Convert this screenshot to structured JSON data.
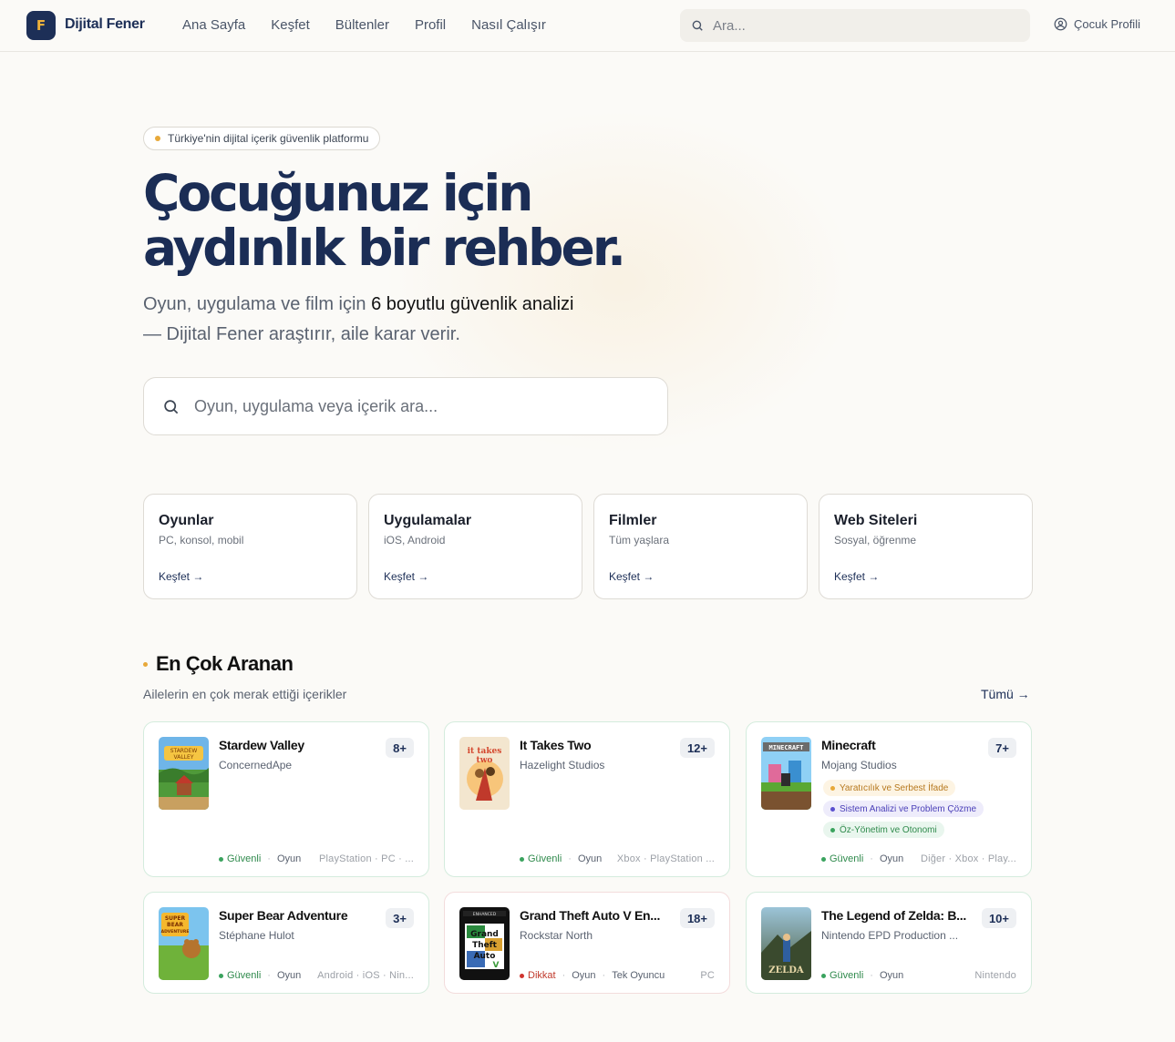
{
  "header": {
    "logo_letter": "F",
    "logo_text": "Dijital Fener",
    "nav": [
      "Ana Sayfa",
      "Keşfet",
      "Bültenler",
      "Profil",
      "Nasıl Çalışır"
    ],
    "search_placeholder": "Ara...",
    "profile_label": "Çocuk Profili"
  },
  "hero": {
    "badge": "Türkiye'nin dijital içerik güvenlik platformu",
    "title_line1": "Çocuğunuz için",
    "title_line2": "aydınlık bir rehber.",
    "sub_pre": "Oyun, uygulama ve film için ",
    "sub_bold": "6 boyutlu güvenlik analizi",
    "sub_post": "— Dijital Fener araştırır, aile karar verir.",
    "search_placeholder": "Oyun, uygulama veya içerik ara..."
  },
  "categories": [
    {
      "title": "Oyunlar",
      "desc": "PC, konsol, mobil",
      "link": "Keşfet →"
    },
    {
      "title": "Uygulamalar",
      "desc": "iOS, Android",
      "link": "Keşfet →"
    },
    {
      "title": "Filmler",
      "desc": "Tüm yaşlara",
      "link": "Keşfet →"
    },
    {
      "title": "Web Siteleri",
      "desc": "Sosyal, öğrenme",
      "link": "Keşfet →"
    }
  ],
  "section": {
    "title": "En Çok Aranan",
    "subtitle": "Ailelerin en çok merak ettiği içerikler",
    "all_link": "Tümü →"
  },
  "games": [
    {
      "name": "Stardew Valley",
      "dev": "ConcernedApe",
      "age": "8+",
      "status": "Güvenli",
      "type": "Oyun",
      "extra": "",
      "platforms": "PlayStation · PC · ...",
      "cover": "stardew"
    },
    {
      "name": "It Takes Two",
      "dev": "Hazelight Studios",
      "age": "12+",
      "status": "Güvenli",
      "type": "Oyun",
      "extra": "",
      "platforms": "Xbox · PlayStation ...",
      "cover": "ittakestwo"
    },
    {
      "name": "Minecraft",
      "dev": "Mojang Studios",
      "age": "7+",
      "status": "Güvenli",
      "type": "Oyun",
      "extra": "",
      "platforms": "Diğer · Xbox · Play...",
      "cover": "minecraft",
      "tags": [
        {
          "label": "Yaratıcılık ve Serbest İfade",
          "color": "#e8a93a",
          "bg": "#fdf4e3",
          "text": "#b7791f"
        },
        {
          "label": "Sistem Analizi ve Problem Çözme",
          "color": "#5a4fcf",
          "bg": "#eeecfb",
          "text": "#4a3fb8"
        },
        {
          "label": "Öz-Yönetim ve Otonomi",
          "color": "#3aa35e",
          "bg": "#e9f6ee",
          "text": "#2f8a4c"
        }
      ]
    },
    {
      "name": "Super Bear Adventure",
      "dev": "Stéphane Hulot",
      "age": "3+",
      "status": "Güvenli",
      "type": "Oyun",
      "extra": "",
      "platforms": "Android · iOS · Nin...",
      "cover": "superbear"
    },
    {
      "name": "Grand Theft Auto V En...",
      "dev": "Rockstar North",
      "age": "18+",
      "status": "Dikkat",
      "type": "Oyun",
      "extra": "Tek Oyuncu",
      "platforms": "PC",
      "cover": "gta"
    },
    {
      "name": "The Legend of Zelda: B...",
      "dev": "Nintendo EPD Production ...",
      "age": "10+",
      "status": "Güvenli",
      "type": "Oyun",
      "extra": "",
      "platforms": "Nintendo",
      "cover": "zelda"
    }
  ],
  "colors": {
    "navy": "#1d2f57",
    "accent": "#e8a93a",
    "safe": "#3aa35e",
    "warning": "#d0352f"
  }
}
